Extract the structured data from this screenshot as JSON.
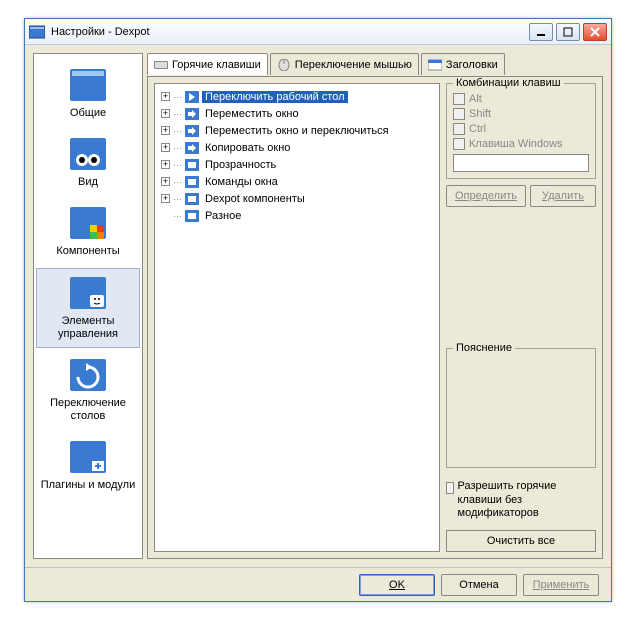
{
  "window": {
    "title": "Настройки - Dexpot"
  },
  "sidebar": {
    "items": [
      {
        "label": "Общие"
      },
      {
        "label": "Вид"
      },
      {
        "label": "Компоненты"
      },
      {
        "label": "Элементы управления"
      },
      {
        "label": "Переключение столов"
      },
      {
        "label": "Плагины и модули"
      }
    ]
  },
  "tabs": {
    "hotkeys": "Горячие клавиши",
    "mouse": "Переключение мышью",
    "titles": "Заголовки"
  },
  "tree": {
    "items": [
      "Переключить рабочий стол",
      "Переместить окно",
      "Переместить окно и переключиться",
      "Копировать окно",
      "Прозрачность",
      "Команды окна",
      "Dexpot компоненты",
      "Разное"
    ]
  },
  "combos": {
    "legend": "Комбинации клавиш",
    "alt": "Alt",
    "shift": "Shift",
    "ctrl": "Ctrl",
    "win": "Клавиша Windows"
  },
  "buttons": {
    "define": "Определить",
    "delete": "Удалить"
  },
  "explain": {
    "legend": "Пояснение"
  },
  "allow": {
    "label": "Разрешить горячие клавиши без модификаторов"
  },
  "clear": {
    "label": "Очистить все"
  },
  "bottom": {
    "ok": "OK",
    "cancel": "Отмена",
    "apply": "Применить"
  }
}
